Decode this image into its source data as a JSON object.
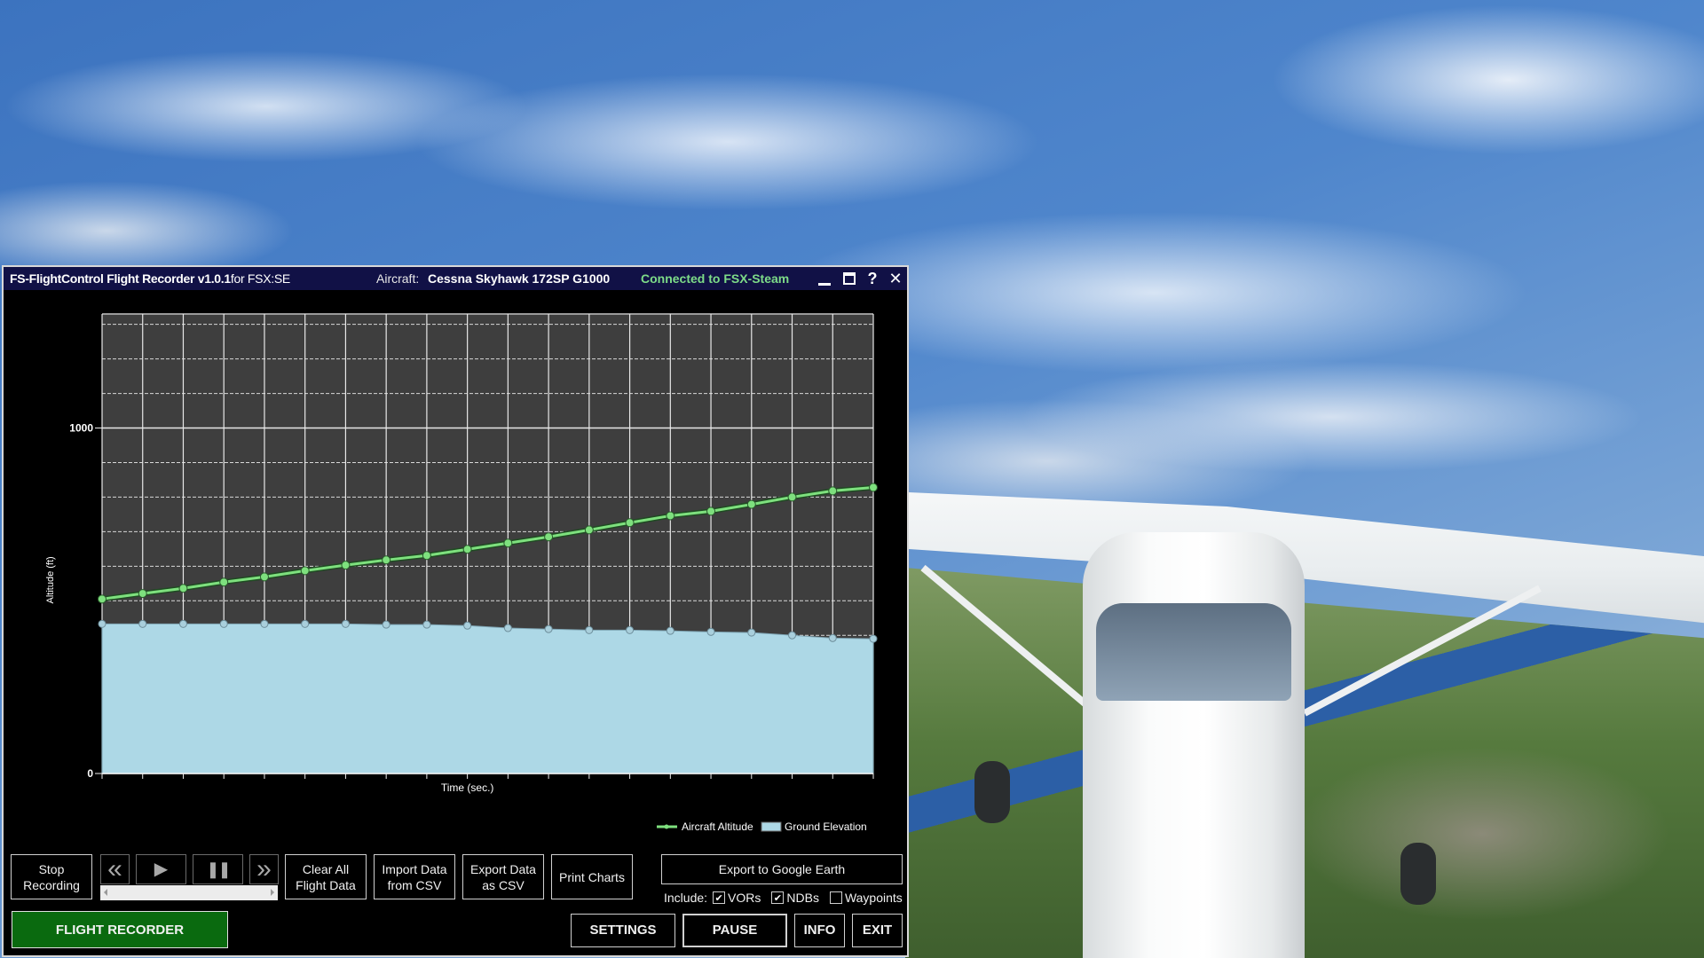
{
  "window": {
    "title": "FS-FlightControl Flight Recorder v1.0.1",
    "title_suffix": "for FSX:SE",
    "aircraft_label": "Aircraft:",
    "aircraft_value": "Cessna Skyhawk 172SP G1000",
    "connection_status": "Connected to FSX-Steam",
    "controls": {
      "minimize": "minimize",
      "maximize": "maximize",
      "help": "?",
      "close": "✕"
    }
  },
  "colors": {
    "title_bar": "#111146",
    "connected": "#7ddc88",
    "altitude_line": "#7ee07e",
    "ground_fill": "#add8e6",
    "plot_bg": "#3e3e3e",
    "flight_recorder_button": "#0a6a0f"
  },
  "chart_data": {
    "type": "line",
    "title": "",
    "xlabel": "Time (sec.)",
    "ylabel": "Altitude (ft)",
    "ylim": [
      0,
      1330
    ],
    "yticks": [
      0,
      1000
    ],
    "ytick_labels": [
      "0",
      "1000"
    ],
    "yminor_gridlines": [
      100,
      200,
      300,
      400,
      500,
      600,
      700,
      800,
      900,
      1100,
      1200,
      1300
    ],
    "x_points": 20,
    "grid": true,
    "legend_position": "bottom-right",
    "series": [
      {
        "name": "Aircraft Altitude",
        "kind": "line",
        "color": "#7ee07e",
        "values": [
          505,
          521,
          536,
          554,
          569,
          587,
          603,
          618,
          631,
          649,
          667,
          685,
          705,
          726,
          746,
          759,
          779,
          800,
          818,
          828
        ]
      },
      {
        "name": "Ground Elevation",
        "kind": "area",
        "color": "#add8e6",
        "values": [
          433,
          433,
          433,
          433,
          433,
          433,
          433,
          431,
          431,
          428,
          421,
          418,
          415,
          415,
          413,
          410,
          408,
          400,
          392,
          390
        ]
      }
    ]
  },
  "controls": {
    "stop_recording": "Stop\nRecording",
    "rewind": "«",
    "play": "▶",
    "pause_media": "❚❚",
    "fast_forward": "»",
    "clear_all": "Clear All\nFlight Data",
    "import_csv": "Import Data\nfrom CSV",
    "export_csv": "Export Data\nas CSV",
    "print_charts": "Print Charts",
    "export_google_earth": "Export to Google Earth",
    "include_label": "Include:",
    "include_options": [
      {
        "label": "VORs",
        "checked": true
      },
      {
        "label": "NDBs",
        "checked": true
      },
      {
        "label": "Waypoints",
        "checked": false
      }
    ],
    "flight_recorder": "FLIGHT RECORDER",
    "settings": "SETTINGS",
    "pause": "PAUSE",
    "info": "INFO",
    "exit": "EXIT"
  }
}
